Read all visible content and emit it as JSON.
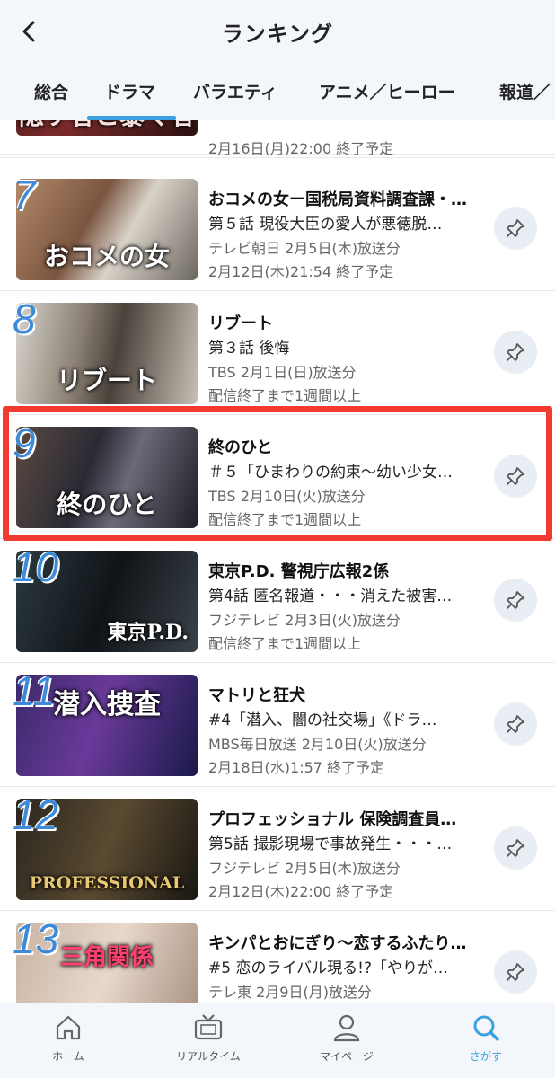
{
  "header": {
    "title": "ランキング"
  },
  "tabs": [
    {
      "label": "総合"
    },
    {
      "label": "ドラマ"
    },
    {
      "label": "バラエティ"
    },
    {
      "label": "アニメ／ヒーロー"
    },
    {
      "label": "報道／"
    }
  ],
  "active_tab": "ドラマ",
  "items": [
    {
      "rank": "",
      "thumb_text": "隠す者と暴く者",
      "title": "",
      "subtitle": "",
      "meta1": "",
      "meta2": "2月16日(月)22:00 終了予定"
    },
    {
      "rank": "7",
      "thumb_text": "おコメの女",
      "title": "おコメの女ー国税局資料調査課・…",
      "subtitle": "第５話 現役大臣の愛人が悪徳脱…",
      "meta1": "テレビ朝日 2月5日(木)放送分",
      "meta2": "2月12日(木)21:54 終了予定"
    },
    {
      "rank": "8",
      "thumb_text": "リブート",
      "title": "リブート",
      "subtitle": "第３話 後悔",
      "meta1": "TBS 2月1日(日)放送分",
      "meta2": "配信終了まで1週間以上"
    },
    {
      "rank": "9",
      "thumb_text": "終のひと",
      "title": "終のひと",
      "subtitle": "＃５「ひまわりの約束〜幼い少女…",
      "meta1": "TBS 2月10日(火)放送分",
      "meta2": "配信終了まで1週間以上"
    },
    {
      "rank": "10",
      "thumb_text": "東京P.D.",
      "title": "東京P.D. 警視庁広報2係",
      "subtitle": "第4話 匿名報道・・・消えた被害…",
      "meta1": "フジテレビ 2月3日(火)放送分",
      "meta2": "配信終了まで1週間以上"
    },
    {
      "rank": "11",
      "thumb_text": "潜入捜査",
      "title": "マトリと狂犬",
      "subtitle": "#4「潜入、闇の社交場」《ドラ…",
      "meta1": "MBS毎日放送 2月10日(火)放送分",
      "meta2": "2月18日(水)1:57 終了予定"
    },
    {
      "rank": "12",
      "thumb_text": "PROFESSIONAL",
      "title": "プロフェッショナル 保険調査員…",
      "subtitle": "第5話 撮影現場で事故発生・・・…",
      "meta1": "フジテレビ 2月5日(木)放送分",
      "meta2": "2月12日(木)22:00 終了予定"
    },
    {
      "rank": "13",
      "thumb_text": "三角関係",
      "title": "キンパとおにぎり〜恋するふたり…",
      "subtitle": "#5 恋のライバル現る!?「やりが…",
      "meta1": "テレ東 2月9日(月)放送分",
      "meta2": ""
    }
  ],
  "bottom_nav": [
    {
      "label": "ホーム",
      "icon": "home-icon"
    },
    {
      "label": "リアルタイム",
      "icon": "tv-icon"
    },
    {
      "label": "マイページ",
      "icon": "person-icon"
    },
    {
      "label": "さがす",
      "icon": "search-icon"
    }
  ],
  "colors": {
    "accent": "#3aa0e0",
    "highlight": "#f23a30",
    "rank": "#3d8bd8"
  }
}
